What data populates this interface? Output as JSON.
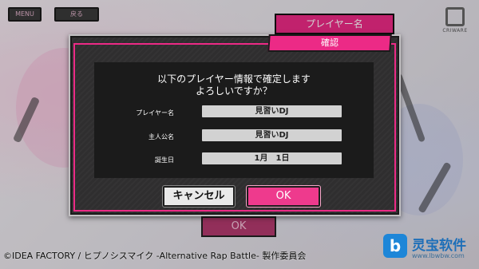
{
  "background": {
    "menu_label": "MENU",
    "back_label": "戻る",
    "title": "プレイヤー名",
    "ok_label": "OK",
    "criware_label": "CRIWARE",
    "copyright": "©IDEA FACTORY / ヒプノシスマイク -Alternative Rap Battle- 製作委員会"
  },
  "watermark": {
    "icon": "b",
    "name": "灵宝软件",
    "url": "www.lbwbw.com"
  },
  "dialog": {
    "title": "確認",
    "message_line1": "以下のプレイヤー情報で確定します",
    "message_line2": "よろしいですか？",
    "rows": [
      {
        "label": "プレイヤー名",
        "value": "見習いDJ"
      },
      {
        "label": "主人公名",
        "value": "見習いDJ"
      },
      {
        "label": "誕生日",
        "value": "1月　1日"
      }
    ],
    "cancel_label": "キャンセル",
    "ok_label": "OK"
  },
  "colors": {
    "accent_pink": "#ec2a86",
    "dialog_bg": "#2f2e2f",
    "panel_bg": "#1b1b1b"
  }
}
